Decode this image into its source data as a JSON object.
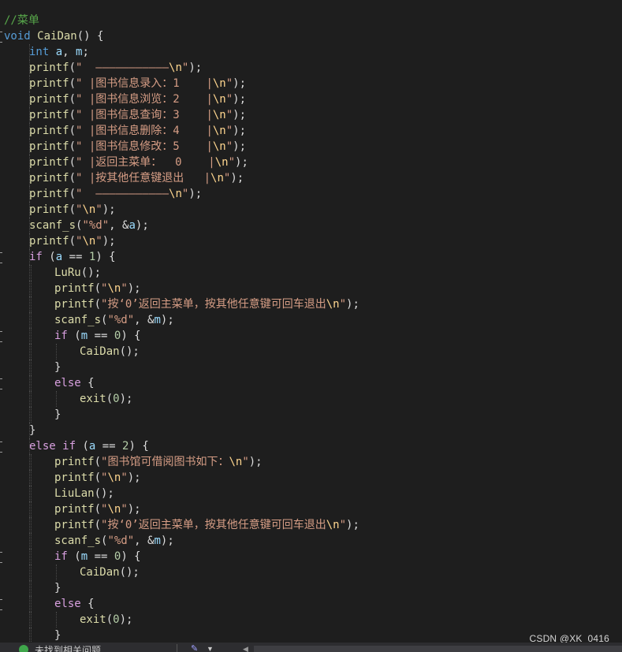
{
  "code": {
    "lines": [
      {
        "indent": 0,
        "fold": false,
        "tokens": [
          {
            "t": "comment",
            "v": "//菜单"
          }
        ]
      },
      {
        "indent": 0,
        "fold": true,
        "tokens": [
          {
            "t": "kw",
            "v": "void"
          },
          {
            "t": "plain",
            "v": " "
          },
          {
            "t": "fn",
            "v": "CaiDan"
          },
          {
            "t": "plain",
            "v": "() {"
          }
        ]
      },
      {
        "indent": 1,
        "fold": false,
        "tokens": [
          {
            "t": "kw",
            "v": "int"
          },
          {
            "t": "plain",
            "v": " "
          },
          {
            "t": "var",
            "v": "a"
          },
          {
            "t": "plain",
            "v": ", "
          },
          {
            "t": "var",
            "v": "m"
          },
          {
            "t": "plain",
            "v": ";"
          }
        ]
      },
      {
        "indent": 1,
        "fold": false,
        "tokens": [
          {
            "t": "fn",
            "v": "printf"
          },
          {
            "t": "plain",
            "v": "("
          },
          {
            "t": "str",
            "v": "\"  ———————————"
          },
          {
            "t": "esc",
            "v": "\\n"
          },
          {
            "t": "str",
            "v": "\""
          },
          {
            "t": "plain",
            "v": ");"
          }
        ]
      },
      {
        "indent": 1,
        "fold": false,
        "tokens": [
          {
            "t": "fn",
            "v": "printf"
          },
          {
            "t": "plain",
            "v": "("
          },
          {
            "t": "str",
            "v": "\" |图书信息录入：1    |"
          },
          {
            "t": "esc",
            "v": "\\n"
          },
          {
            "t": "str",
            "v": "\""
          },
          {
            "t": "plain",
            "v": ");"
          }
        ]
      },
      {
        "indent": 1,
        "fold": false,
        "tokens": [
          {
            "t": "fn",
            "v": "printf"
          },
          {
            "t": "plain",
            "v": "("
          },
          {
            "t": "str",
            "v": "\" |图书信息浏览：2    |"
          },
          {
            "t": "esc",
            "v": "\\n"
          },
          {
            "t": "str",
            "v": "\""
          },
          {
            "t": "plain",
            "v": ");"
          }
        ]
      },
      {
        "indent": 1,
        "fold": false,
        "tokens": [
          {
            "t": "fn",
            "v": "printf"
          },
          {
            "t": "plain",
            "v": "("
          },
          {
            "t": "str",
            "v": "\" |图书信息查询：3    |"
          },
          {
            "t": "esc",
            "v": "\\n"
          },
          {
            "t": "str",
            "v": "\""
          },
          {
            "t": "plain",
            "v": ");"
          }
        ]
      },
      {
        "indent": 1,
        "fold": false,
        "tokens": [
          {
            "t": "fn",
            "v": "printf"
          },
          {
            "t": "plain",
            "v": "("
          },
          {
            "t": "str",
            "v": "\" |图书信息删除：4    |"
          },
          {
            "t": "esc",
            "v": "\\n"
          },
          {
            "t": "str",
            "v": "\""
          },
          {
            "t": "plain",
            "v": ");"
          }
        ]
      },
      {
        "indent": 1,
        "fold": false,
        "tokens": [
          {
            "t": "fn",
            "v": "printf"
          },
          {
            "t": "plain",
            "v": "("
          },
          {
            "t": "str",
            "v": "\" |图书信息修改：5    |"
          },
          {
            "t": "esc",
            "v": "\\n"
          },
          {
            "t": "str",
            "v": "\""
          },
          {
            "t": "plain",
            "v": ");"
          }
        ]
      },
      {
        "indent": 1,
        "fold": false,
        "tokens": [
          {
            "t": "fn",
            "v": "printf"
          },
          {
            "t": "plain",
            "v": "("
          },
          {
            "t": "str",
            "v": "\" |返回主菜单：  0    |"
          },
          {
            "t": "esc",
            "v": "\\n"
          },
          {
            "t": "str",
            "v": "\""
          },
          {
            "t": "plain",
            "v": ");"
          }
        ]
      },
      {
        "indent": 1,
        "fold": false,
        "tokens": [
          {
            "t": "fn",
            "v": "printf"
          },
          {
            "t": "plain",
            "v": "("
          },
          {
            "t": "str",
            "v": "\" |按其他任意键退出   |"
          },
          {
            "t": "esc",
            "v": "\\n"
          },
          {
            "t": "str",
            "v": "\""
          },
          {
            "t": "plain",
            "v": ");"
          }
        ]
      },
      {
        "indent": 1,
        "fold": false,
        "tokens": [
          {
            "t": "fn",
            "v": "printf"
          },
          {
            "t": "plain",
            "v": "("
          },
          {
            "t": "str",
            "v": "\"  ———————————"
          },
          {
            "t": "esc",
            "v": "\\n"
          },
          {
            "t": "str",
            "v": "\""
          },
          {
            "t": "plain",
            "v": ");"
          }
        ]
      },
      {
        "indent": 1,
        "fold": false,
        "tokens": [
          {
            "t": "fn",
            "v": "printf"
          },
          {
            "t": "plain",
            "v": "("
          },
          {
            "t": "str",
            "v": "\""
          },
          {
            "t": "esc",
            "v": "\\n"
          },
          {
            "t": "str",
            "v": "\""
          },
          {
            "t": "plain",
            "v": ");"
          }
        ]
      },
      {
        "indent": 1,
        "fold": false,
        "tokens": [
          {
            "t": "fn",
            "v": "scanf_s"
          },
          {
            "t": "plain",
            "v": "("
          },
          {
            "t": "str",
            "v": "\"%d\""
          },
          {
            "t": "plain",
            "v": ", &"
          },
          {
            "t": "var",
            "v": "a"
          },
          {
            "t": "plain",
            "v": ");"
          }
        ]
      },
      {
        "indent": 1,
        "fold": false,
        "tokens": [
          {
            "t": "fn",
            "v": "printf"
          },
          {
            "t": "plain",
            "v": "("
          },
          {
            "t": "str",
            "v": "\""
          },
          {
            "t": "esc",
            "v": "\\n"
          },
          {
            "t": "str",
            "v": "\""
          },
          {
            "t": "plain",
            "v": ");"
          }
        ]
      },
      {
        "indent": 1,
        "fold": true,
        "tokens": [
          {
            "t": "ctrl",
            "v": "if"
          },
          {
            "t": "plain",
            "v": " ("
          },
          {
            "t": "var",
            "v": "a"
          },
          {
            "t": "plain",
            "v": " == "
          },
          {
            "t": "num",
            "v": "1"
          },
          {
            "t": "plain",
            "v": ") {"
          }
        ]
      },
      {
        "indent": 2,
        "fold": false,
        "tokens": [
          {
            "t": "fn",
            "v": "LuRu"
          },
          {
            "t": "plain",
            "v": "();"
          }
        ]
      },
      {
        "indent": 2,
        "fold": false,
        "tokens": [
          {
            "t": "fn",
            "v": "printf"
          },
          {
            "t": "plain",
            "v": "("
          },
          {
            "t": "str",
            "v": "\""
          },
          {
            "t": "esc",
            "v": "\\n"
          },
          {
            "t": "str",
            "v": "\""
          },
          {
            "t": "plain",
            "v": ");"
          }
        ]
      },
      {
        "indent": 2,
        "fold": false,
        "tokens": [
          {
            "t": "fn",
            "v": "printf"
          },
          {
            "t": "plain",
            "v": "("
          },
          {
            "t": "str",
            "v": "\"按‘0’返回主菜单，按其他任意键可回车退出"
          },
          {
            "t": "esc",
            "v": "\\n"
          },
          {
            "t": "str",
            "v": "\""
          },
          {
            "t": "plain",
            "v": ");"
          }
        ]
      },
      {
        "indent": 2,
        "fold": false,
        "tokens": [
          {
            "t": "fn",
            "v": "scanf_s"
          },
          {
            "t": "plain",
            "v": "("
          },
          {
            "t": "str",
            "v": "\"%d\""
          },
          {
            "t": "plain",
            "v": ", &"
          },
          {
            "t": "var",
            "v": "m"
          },
          {
            "t": "plain",
            "v": ");"
          }
        ]
      },
      {
        "indent": 2,
        "fold": true,
        "tokens": [
          {
            "t": "ctrl",
            "v": "if"
          },
          {
            "t": "plain",
            "v": " ("
          },
          {
            "t": "var",
            "v": "m"
          },
          {
            "t": "plain",
            "v": " == "
          },
          {
            "t": "num",
            "v": "0"
          },
          {
            "t": "plain",
            "v": ") {"
          }
        ]
      },
      {
        "indent": 3,
        "fold": false,
        "tokens": [
          {
            "t": "fn",
            "v": "CaiDan"
          },
          {
            "t": "plain",
            "v": "();"
          }
        ]
      },
      {
        "indent": 2,
        "fold": false,
        "tokens": [
          {
            "t": "plain",
            "v": "}"
          }
        ]
      },
      {
        "indent": 2,
        "fold": true,
        "tokens": [
          {
            "t": "ctrl",
            "v": "else"
          },
          {
            "t": "plain",
            "v": " {"
          }
        ]
      },
      {
        "indent": 3,
        "fold": false,
        "tokens": [
          {
            "t": "fn",
            "v": "exit"
          },
          {
            "t": "plain",
            "v": "("
          },
          {
            "t": "num",
            "v": "0"
          },
          {
            "t": "plain",
            "v": ");"
          }
        ]
      },
      {
        "indent": 2,
        "fold": false,
        "tokens": [
          {
            "t": "plain",
            "v": "}"
          }
        ]
      },
      {
        "indent": 1,
        "fold": false,
        "tokens": [
          {
            "t": "plain",
            "v": "}"
          }
        ]
      },
      {
        "indent": 1,
        "fold": true,
        "tokens": [
          {
            "t": "ctrl",
            "v": "else"
          },
          {
            "t": "plain",
            "v": " "
          },
          {
            "t": "ctrl",
            "v": "if"
          },
          {
            "t": "plain",
            "v": " ("
          },
          {
            "t": "var",
            "v": "a"
          },
          {
            "t": "plain",
            "v": " == "
          },
          {
            "t": "num",
            "v": "2"
          },
          {
            "t": "plain",
            "v": ") {"
          }
        ]
      },
      {
        "indent": 2,
        "fold": false,
        "tokens": [
          {
            "t": "fn",
            "v": "printf"
          },
          {
            "t": "plain",
            "v": "("
          },
          {
            "t": "str",
            "v": "\"图书馆可借阅图书如下："
          },
          {
            "t": "esc",
            "v": "\\n"
          },
          {
            "t": "str",
            "v": "\""
          },
          {
            "t": "plain",
            "v": ");"
          }
        ]
      },
      {
        "indent": 2,
        "fold": false,
        "tokens": [
          {
            "t": "fn",
            "v": "printf"
          },
          {
            "t": "plain",
            "v": "("
          },
          {
            "t": "str",
            "v": "\""
          },
          {
            "t": "esc",
            "v": "\\n"
          },
          {
            "t": "str",
            "v": "\""
          },
          {
            "t": "plain",
            "v": ");"
          }
        ]
      },
      {
        "indent": 2,
        "fold": false,
        "tokens": [
          {
            "t": "fn",
            "v": "LiuLan"
          },
          {
            "t": "plain",
            "v": "();"
          }
        ]
      },
      {
        "indent": 2,
        "fold": false,
        "tokens": [
          {
            "t": "fn",
            "v": "printf"
          },
          {
            "t": "plain",
            "v": "("
          },
          {
            "t": "str",
            "v": "\""
          },
          {
            "t": "esc",
            "v": "\\n"
          },
          {
            "t": "str",
            "v": "\""
          },
          {
            "t": "plain",
            "v": ");"
          }
        ]
      },
      {
        "indent": 2,
        "fold": false,
        "tokens": [
          {
            "t": "fn",
            "v": "printf"
          },
          {
            "t": "plain",
            "v": "("
          },
          {
            "t": "str",
            "v": "\"按‘0’返回主菜单，按其他任意键可回车退出"
          },
          {
            "t": "esc",
            "v": "\\n"
          },
          {
            "t": "str",
            "v": "\""
          },
          {
            "t": "plain",
            "v": ");"
          }
        ]
      },
      {
        "indent": 2,
        "fold": false,
        "tokens": [
          {
            "t": "fn",
            "v": "scanf_s"
          },
          {
            "t": "plain",
            "v": "("
          },
          {
            "t": "str",
            "v": "\"%d\""
          },
          {
            "t": "plain",
            "v": ", &"
          },
          {
            "t": "var",
            "v": "m"
          },
          {
            "t": "plain",
            "v": ");"
          }
        ]
      },
      {
        "indent": 2,
        "fold": true,
        "tokens": [
          {
            "t": "ctrl",
            "v": "if"
          },
          {
            "t": "plain",
            "v": " ("
          },
          {
            "t": "var",
            "v": "m"
          },
          {
            "t": "plain",
            "v": " == "
          },
          {
            "t": "num",
            "v": "0"
          },
          {
            "t": "plain",
            "v": ") {"
          }
        ]
      },
      {
        "indent": 3,
        "fold": false,
        "tokens": [
          {
            "t": "fn",
            "v": "CaiDan"
          },
          {
            "t": "plain",
            "v": "();"
          }
        ]
      },
      {
        "indent": 2,
        "fold": false,
        "tokens": [
          {
            "t": "plain",
            "v": "}"
          }
        ]
      },
      {
        "indent": 2,
        "fold": true,
        "tokens": [
          {
            "t": "ctrl",
            "v": "else"
          },
          {
            "t": "plain",
            "v": " {"
          }
        ]
      },
      {
        "indent": 3,
        "fold": false,
        "tokens": [
          {
            "t": "fn",
            "v": "exit"
          },
          {
            "t": "plain",
            "v": "("
          },
          {
            "t": "num",
            "v": "0"
          },
          {
            "t": "plain",
            "v": ");"
          }
        ]
      },
      {
        "indent": 2,
        "fold": false,
        "tokens": [
          {
            "t": "plain",
            "v": "}"
          }
        ]
      }
    ]
  },
  "statusbar": {
    "check_icon": "check-circle-icon",
    "message": "未找到相关问题"
  },
  "watermark": {
    "text": "CSDN @XK_0416"
  },
  "colors": {
    "background": "#1e1e1e",
    "comment": "#57a64a",
    "keyword": "#569cd6",
    "control": "#d8a0df",
    "function": "#dcdcaa",
    "string": "#d69d85",
    "variable": "#9cdcfe",
    "number": "#b5cea8"
  }
}
